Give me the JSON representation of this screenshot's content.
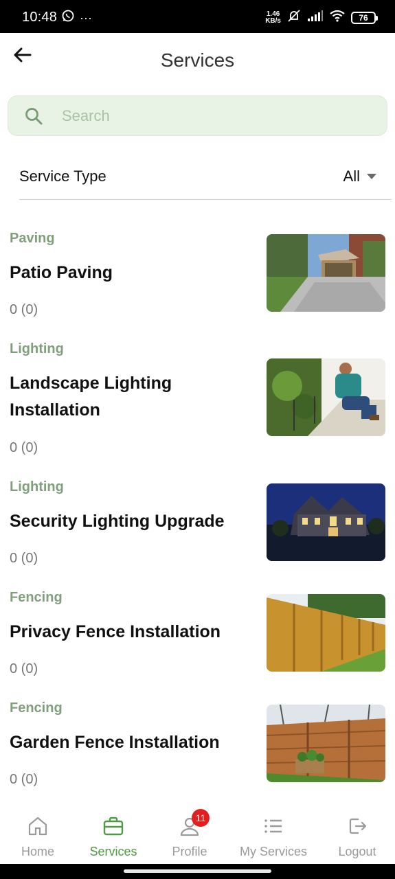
{
  "status_bar": {
    "time": "10:48",
    "net_speed_value": "1.46",
    "net_speed_unit": "KB/s",
    "battery": "76"
  },
  "header": {
    "title": "Services"
  },
  "search": {
    "placeholder": "Search",
    "value": ""
  },
  "filter": {
    "label": "Service Type",
    "selected": "All"
  },
  "services": [
    {
      "category": "Paving",
      "name": "Patio Paving",
      "rating": "0 (0)"
    },
    {
      "category": "Lighting",
      "name": "Landscape Lighting Installation",
      "rating": "0 (0)"
    },
    {
      "category": "Lighting",
      "name": "Security Lighting Upgrade",
      "rating": "0 (0)"
    },
    {
      "category": "Fencing",
      "name": "Privacy Fence Installation",
      "rating": "0 (0)"
    },
    {
      "category": "Fencing",
      "name": "Garden Fence Installation",
      "rating": "0 (0)"
    }
  ],
  "bottom_nav": {
    "items": [
      {
        "label": "Home",
        "icon": "home-icon"
      },
      {
        "label": "Services",
        "icon": "briefcase-icon"
      },
      {
        "label": "Profile",
        "icon": "user-icon",
        "badge": "11"
      },
      {
        "label": "My Services",
        "icon": "list-icon"
      },
      {
        "label": "Logout",
        "icon": "logout-icon"
      }
    ],
    "active": "Services"
  },
  "colors": {
    "accent": "#4f9a42",
    "category_text": "#7fa07b",
    "search_bg": "#e9f3e5",
    "badge": "#e41e1e"
  }
}
